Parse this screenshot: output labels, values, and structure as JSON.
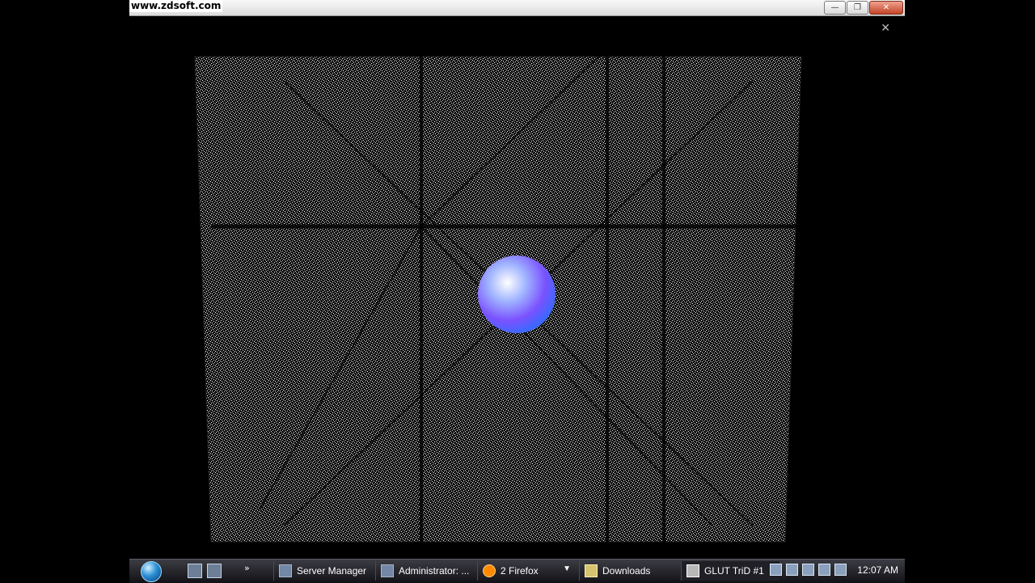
{
  "window": {
    "watermark": "www.zdsoft.com",
    "buttons": {
      "minimize": "—",
      "restore": "❐",
      "close": "✕"
    },
    "overlay_close": "✕"
  },
  "scene": {
    "description": "",
    "sphere_colors": [
      "#2f6cff",
      "#7a52ff",
      "#b05dff",
      "#ffffff"
    ]
  },
  "taskbar": {
    "items": [
      {
        "label": "Server Manager",
        "icon": "server-manager-icon"
      },
      {
        "label": "Administrator: ...",
        "icon": "terminal-icon"
      },
      {
        "label": "2 Firefox",
        "icon": "firefox-icon"
      },
      {
        "label": "Downloads",
        "icon": "folder-icon"
      },
      {
        "label": "GLUT TriD #1",
        "icon": "app-window-icon"
      }
    ],
    "chevron": "»",
    "tray": {
      "clock": "12:07 AM"
    }
  }
}
